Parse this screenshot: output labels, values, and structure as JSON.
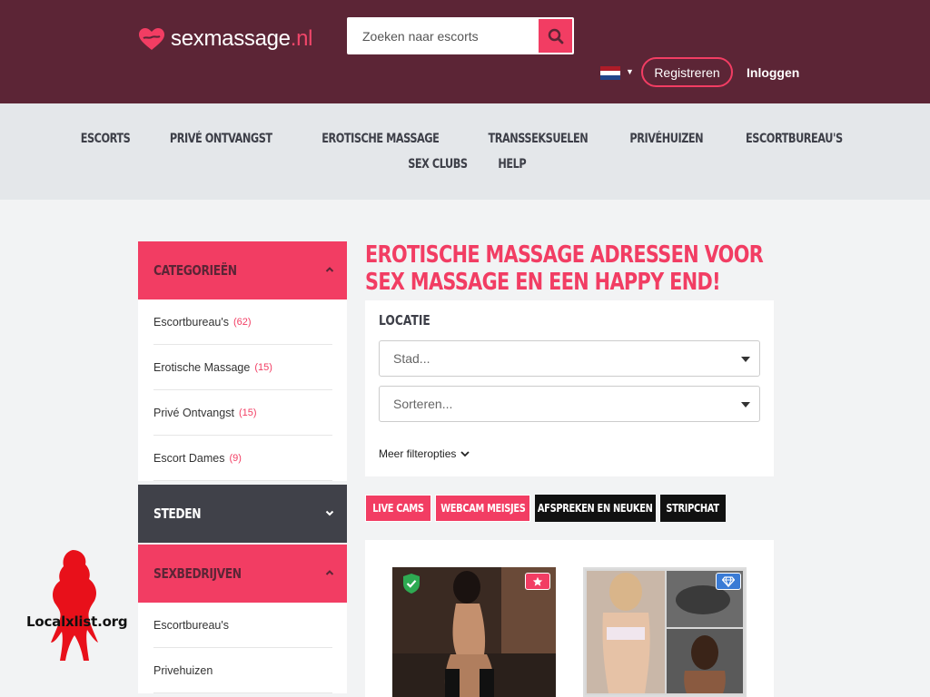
{
  "header": {
    "logo_main": "sexmassage",
    "logo_tld": ".nl",
    "search_placeholder": "Zoeken naar escorts",
    "register_label": "Registreren",
    "login_label": "Inloggen"
  },
  "nav": {
    "row1": [
      "ESCORTS",
      "PRIVÉ ONTVANGST",
      "EROTISCHE MASSAGE",
      "TRANSSEKSUELEN",
      "PRIVÉHUIZEN",
      "ESCORTBUREAU'S"
    ],
    "row2": [
      "SEX CLUBS",
      "HELP"
    ]
  },
  "sidebar": {
    "categories_title": "CATEGORIEËN",
    "categories": [
      {
        "label": "Escortbureau's",
        "count": "(62)"
      },
      {
        "label": "Erotische Massage",
        "count": "(15)"
      },
      {
        "label": "Privé Ontvangst",
        "count": "(15)"
      },
      {
        "label": "Escort Dames",
        "count": "(9)"
      }
    ],
    "cities_title": "STEDEN",
    "businesses_title": "SEXBEDRIJVEN",
    "businesses": [
      {
        "label": "Escortbureau's"
      },
      {
        "label": "Privehuizen"
      }
    ]
  },
  "main": {
    "title": "EROTISCHE MASSAGE ADRESSEN VOOR SEX MASSAGE EN EEN HAPPY END!",
    "filter": {
      "location_label": "LOCATIE",
      "city_placeholder": "Stad...",
      "sort_placeholder": "Sorteren...",
      "more_filters": "Meer filteropties"
    },
    "tags": [
      "LIVE CAMS",
      "WEBCAM MEISJES",
      "AFSPREKEN EN NEUKEN",
      "STRIPCHAT"
    ]
  },
  "watermark": {
    "text": "Localxlist.org"
  },
  "colors": {
    "header_bg": "#5c2536",
    "accent": "#f23d63",
    "nav_bg": "#e4e7ea",
    "dark_panel": "#404149"
  }
}
